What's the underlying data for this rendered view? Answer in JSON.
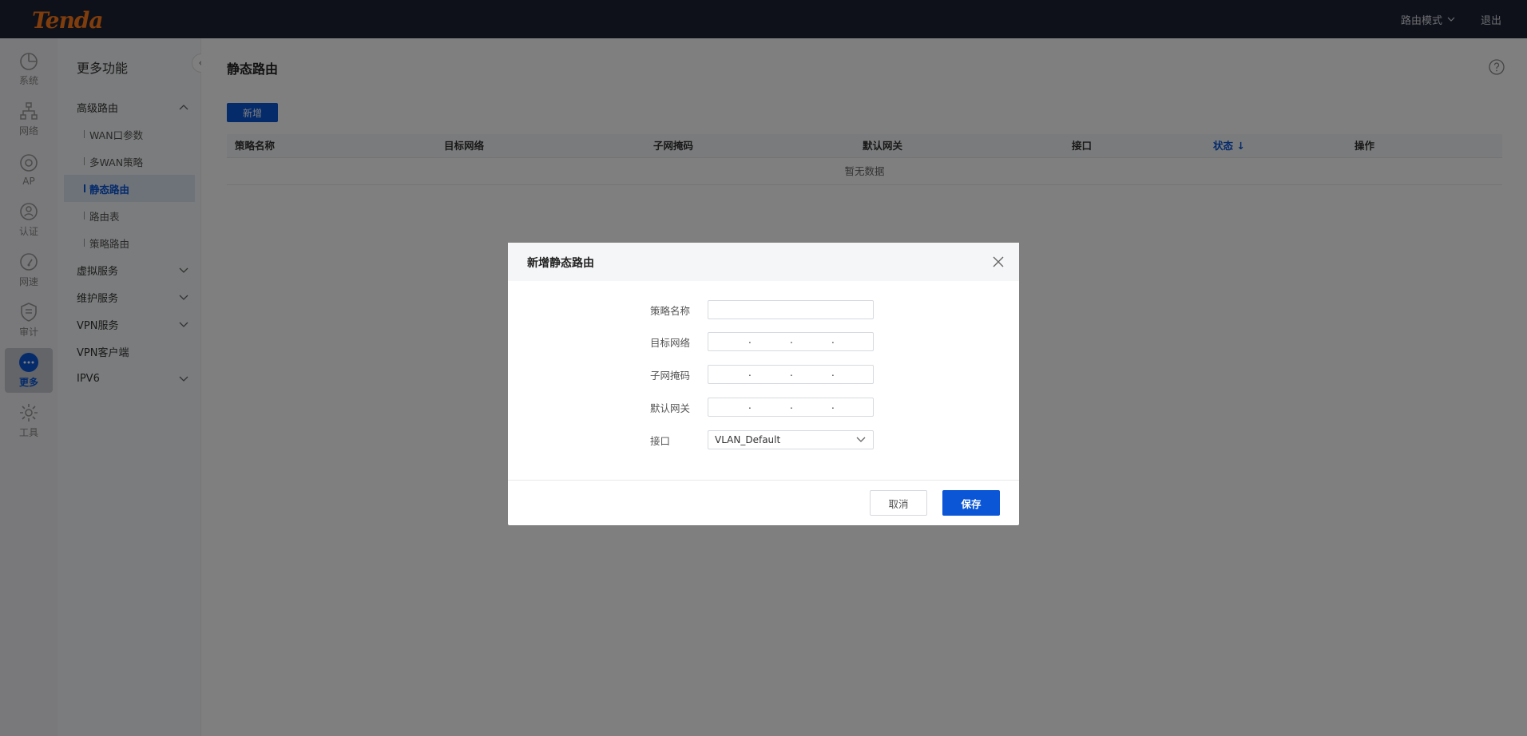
{
  "brand": {
    "logo_text": "Tenda",
    "logo_color": "#ff7a1a"
  },
  "topbar": {
    "mode_label": "路由模式",
    "logout_label": "退出"
  },
  "rail": {
    "items": [
      {
        "label": "系统",
        "icon": "pie-chart-icon"
      },
      {
        "label": "网络",
        "icon": "network-topology-icon"
      },
      {
        "label": "AP",
        "icon": "access-point-icon"
      },
      {
        "label": "认证",
        "icon": "user-auth-icon"
      },
      {
        "label": "网速",
        "icon": "speed-gauge-icon"
      },
      {
        "label": "审计",
        "icon": "shield-audit-icon"
      },
      {
        "label": "更多",
        "icon": "more-dots-icon",
        "active": true
      },
      {
        "label": "工具",
        "icon": "gear-icon"
      }
    ]
  },
  "sidebar": {
    "title": "更多功能",
    "groups": [
      {
        "label": "高级路由",
        "expanded": true,
        "items": [
          {
            "label": "WAN口参数"
          },
          {
            "label": "多WAN策略"
          },
          {
            "label": "静态路由",
            "active": true
          },
          {
            "label": "路由表"
          },
          {
            "label": "策略路由"
          }
        ]
      },
      {
        "label": "虚拟服务",
        "expanded": false
      },
      {
        "label": "维护服务",
        "expanded": false
      },
      {
        "label": "VPN服务",
        "expanded": false
      },
      {
        "label": "VPN客户端"
      },
      {
        "label": "IPV6",
        "expanded": false
      }
    ]
  },
  "main": {
    "title": "静态路由",
    "add_button": "新增",
    "table": {
      "columns": [
        "策略名称",
        "目标网络",
        "子网掩码",
        "默认网关",
        "接口",
        "状态 ↓",
        "操作"
      ],
      "empty_text": "暂无数据"
    }
  },
  "modal": {
    "title": "新增静态路由",
    "fields": {
      "policy_name": {
        "label": "策略名称",
        "value": ""
      },
      "target_network": {
        "label": "目标网络",
        "value": [
          "",
          "",
          "",
          ""
        ]
      },
      "subnet_mask": {
        "label": "子网掩码",
        "value": [
          "",
          "",
          "",
          ""
        ]
      },
      "gateway": {
        "label": "默认网关",
        "value": [
          "",
          "",
          "",
          ""
        ]
      },
      "interface": {
        "label": "接口",
        "value": "VLAN_Default"
      }
    },
    "cancel_label": "取消",
    "save_label": "保存"
  },
  "colors": {
    "accent": "#0a56d6",
    "topbar": "#1c2233"
  }
}
